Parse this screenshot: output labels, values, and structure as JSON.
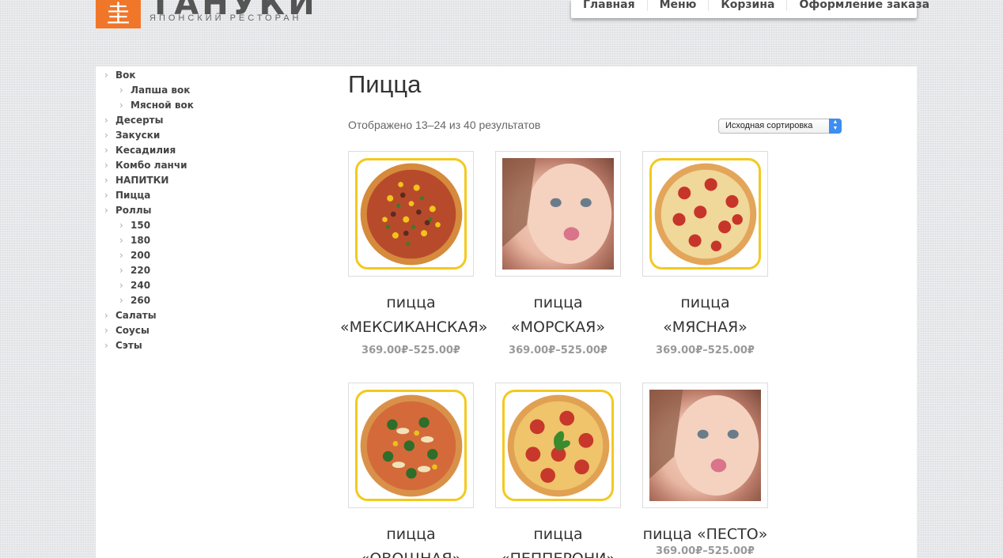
{
  "header": {
    "logo_glyph": "圭",
    "logo_name": "ТАНУКИ",
    "logo_tagline": "ЯПОНСКИЙ РЕСТОРАН",
    "accent": "#f0772a",
    "nav": [
      "Главная",
      "Меню",
      "Корзина",
      "Оформление заказа"
    ]
  },
  "sidebar": {
    "categories": [
      {
        "label": "Вок",
        "level": 0
      },
      {
        "label": "Лапша вок",
        "level": 1
      },
      {
        "label": "Мясной вок",
        "level": 1
      },
      {
        "label": "Десерты",
        "level": 0
      },
      {
        "label": "Закуски",
        "level": 0
      },
      {
        "label": "Кесадилия",
        "level": 0
      },
      {
        "label": "Комбо ланчи",
        "level": 0
      },
      {
        "label": "НАПИТКИ",
        "level": 0
      },
      {
        "label": "Пицца",
        "level": 0
      },
      {
        "label": "Роллы",
        "level": 0
      },
      {
        "label": "150",
        "level": 1
      },
      {
        "label": "180",
        "level": 1
      },
      {
        "label": "200",
        "level": 1
      },
      {
        "label": "220",
        "level": 1
      },
      {
        "label": "240",
        "level": 1
      },
      {
        "label": "260",
        "level": 1
      },
      {
        "label": "Салаты",
        "level": 0
      },
      {
        "label": "Соусы",
        "level": 0
      },
      {
        "label": "Сэты",
        "level": 0
      }
    ]
  },
  "main": {
    "title": "Пицца",
    "result_count": "Отображено 13–24 из 40 результатов",
    "sort_selected": "Исходная сортировка",
    "products": [
      {
        "line1": "пицца",
        "line2": "«МЕКСИКАНСКАЯ»",
        "price": "369.00₽–525.00₽",
        "image": "pizza-mexican"
      },
      {
        "line1": "пицца",
        "line2": "«МОРСКАЯ»",
        "price": "369.00₽–525.00₽",
        "image": "placeholder-baby"
      },
      {
        "line1": "пицца",
        "line2": "«МЯСНАЯ»",
        "price": "369.00₽–525.00₽",
        "image": "pizza-meat"
      },
      {
        "line1": "пицца",
        "line2": "«ОВОЩНАЯ»",
        "price": "",
        "image": "pizza-vegetable"
      },
      {
        "line1": "пицца",
        "line2": "«ПЕППЕРОНИ»",
        "price": "",
        "image": "pizza-pepperoni"
      },
      {
        "line1": "пицца «ПЕСТО»",
        "line2": "",
        "price": "369.00₽–525.00₽",
        "image": "placeholder-baby"
      }
    ]
  }
}
